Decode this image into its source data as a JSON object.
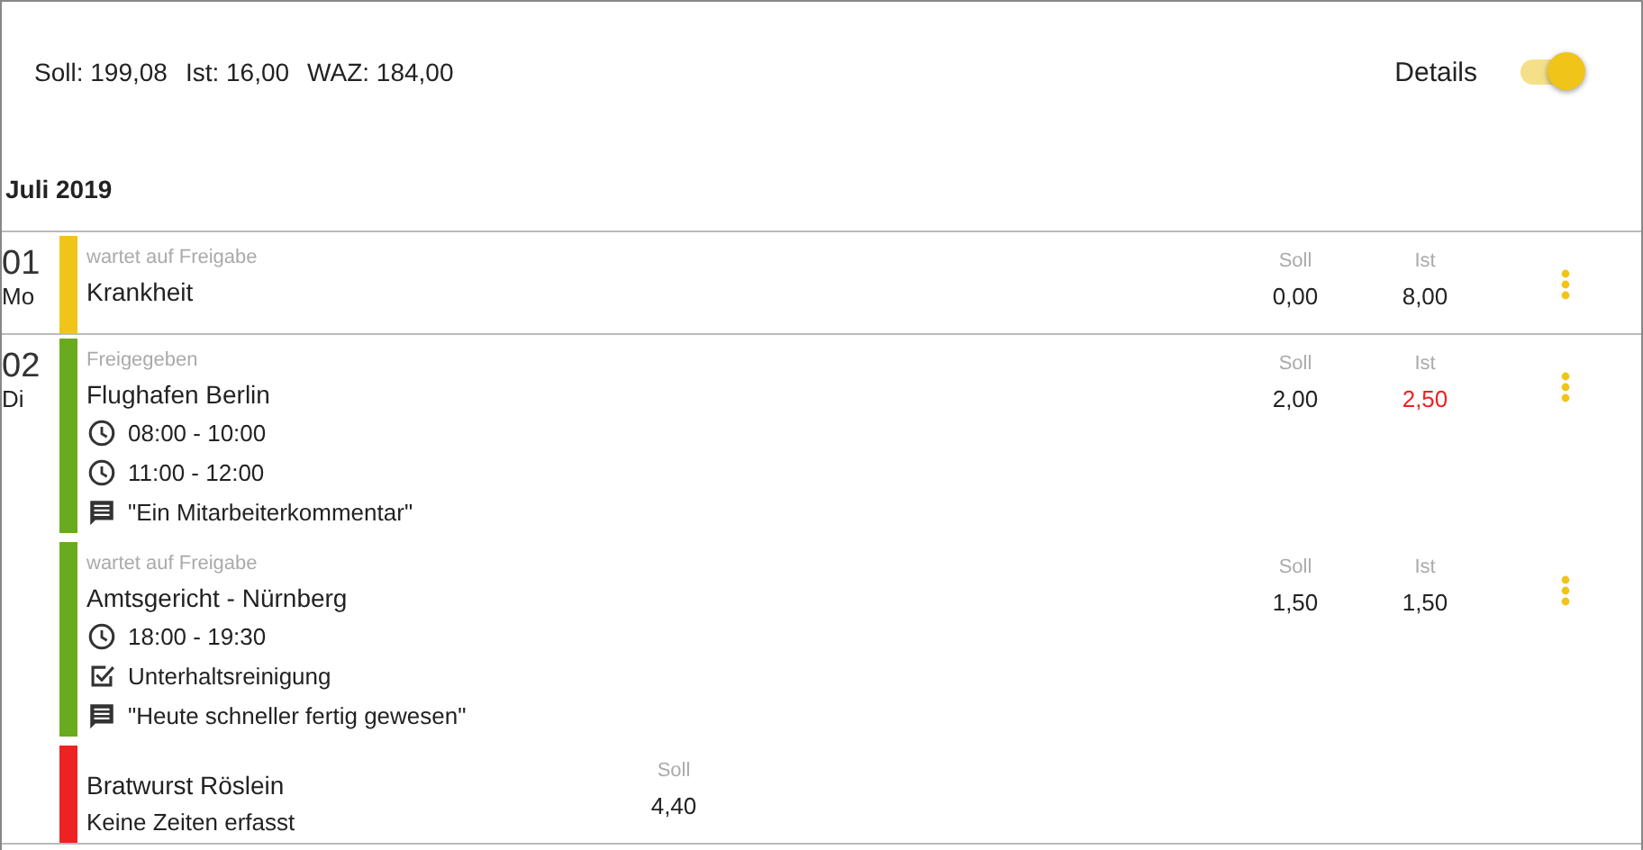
{
  "summary": [
    {
      "label": "Soll:",
      "value": "199,08"
    },
    {
      "label": "Ist:",
      "value": "16,00"
    },
    {
      "label": "WAZ:",
      "value": "184,00"
    }
  ],
  "details_toggle": {
    "label": "Details",
    "on": true
  },
  "month": "Juli 2019",
  "days": [
    {
      "number": "01",
      "weekday": "Mo",
      "entries": [
        {
          "kind": "booking",
          "color": "#f0c419",
          "status": "wartet auf Freigabe",
          "title": "Krankheit",
          "soll_label": "Soll",
          "soll": "0,00",
          "ist_label": "Ist",
          "ist": "8,00",
          "ist_alert": false
        }
      ]
    },
    {
      "number": "02",
      "weekday": "Di",
      "entries": [
        {
          "kind": "booking",
          "color": "#6aaa1e",
          "status": "Freigegeben",
          "title": "Flughafen Berlin",
          "lines": [
            {
              "kind": "time",
              "text": "08:00 - 10:00"
            },
            {
              "kind": "time",
              "text": "11:00 - 12:00"
            },
            {
              "kind": "comment",
              "text": "\"Ein Mitarbeiterkommentar\""
            }
          ],
          "soll_label": "Soll",
          "soll": "2,00",
          "ist_label": "Ist",
          "ist": "2,50",
          "ist_alert": true
        },
        {
          "kind": "booking",
          "color": "#6aaa1e",
          "status": "wartet auf Freigabe",
          "title": "Amtsgericht - Nürnberg",
          "lines": [
            {
              "kind": "time",
              "text": "18:00 - 19:30"
            },
            {
              "kind": "task",
              "text": "Unterhaltsreinigung"
            },
            {
              "kind": "comment",
              "text": "\"Heute schneller fertig gewesen\""
            }
          ],
          "soll_label": "Soll",
          "soll": "1,50",
          "ist_label": "Ist",
          "ist": "1,50",
          "ist_alert": false
        },
        {
          "kind": "planned",
          "color": "#ee2222",
          "title": "Bratwurst Röslein",
          "note": "Keine Zeiten erfasst",
          "soll_label": "Soll",
          "soll": "4,40"
        }
      ]
    }
  ]
}
